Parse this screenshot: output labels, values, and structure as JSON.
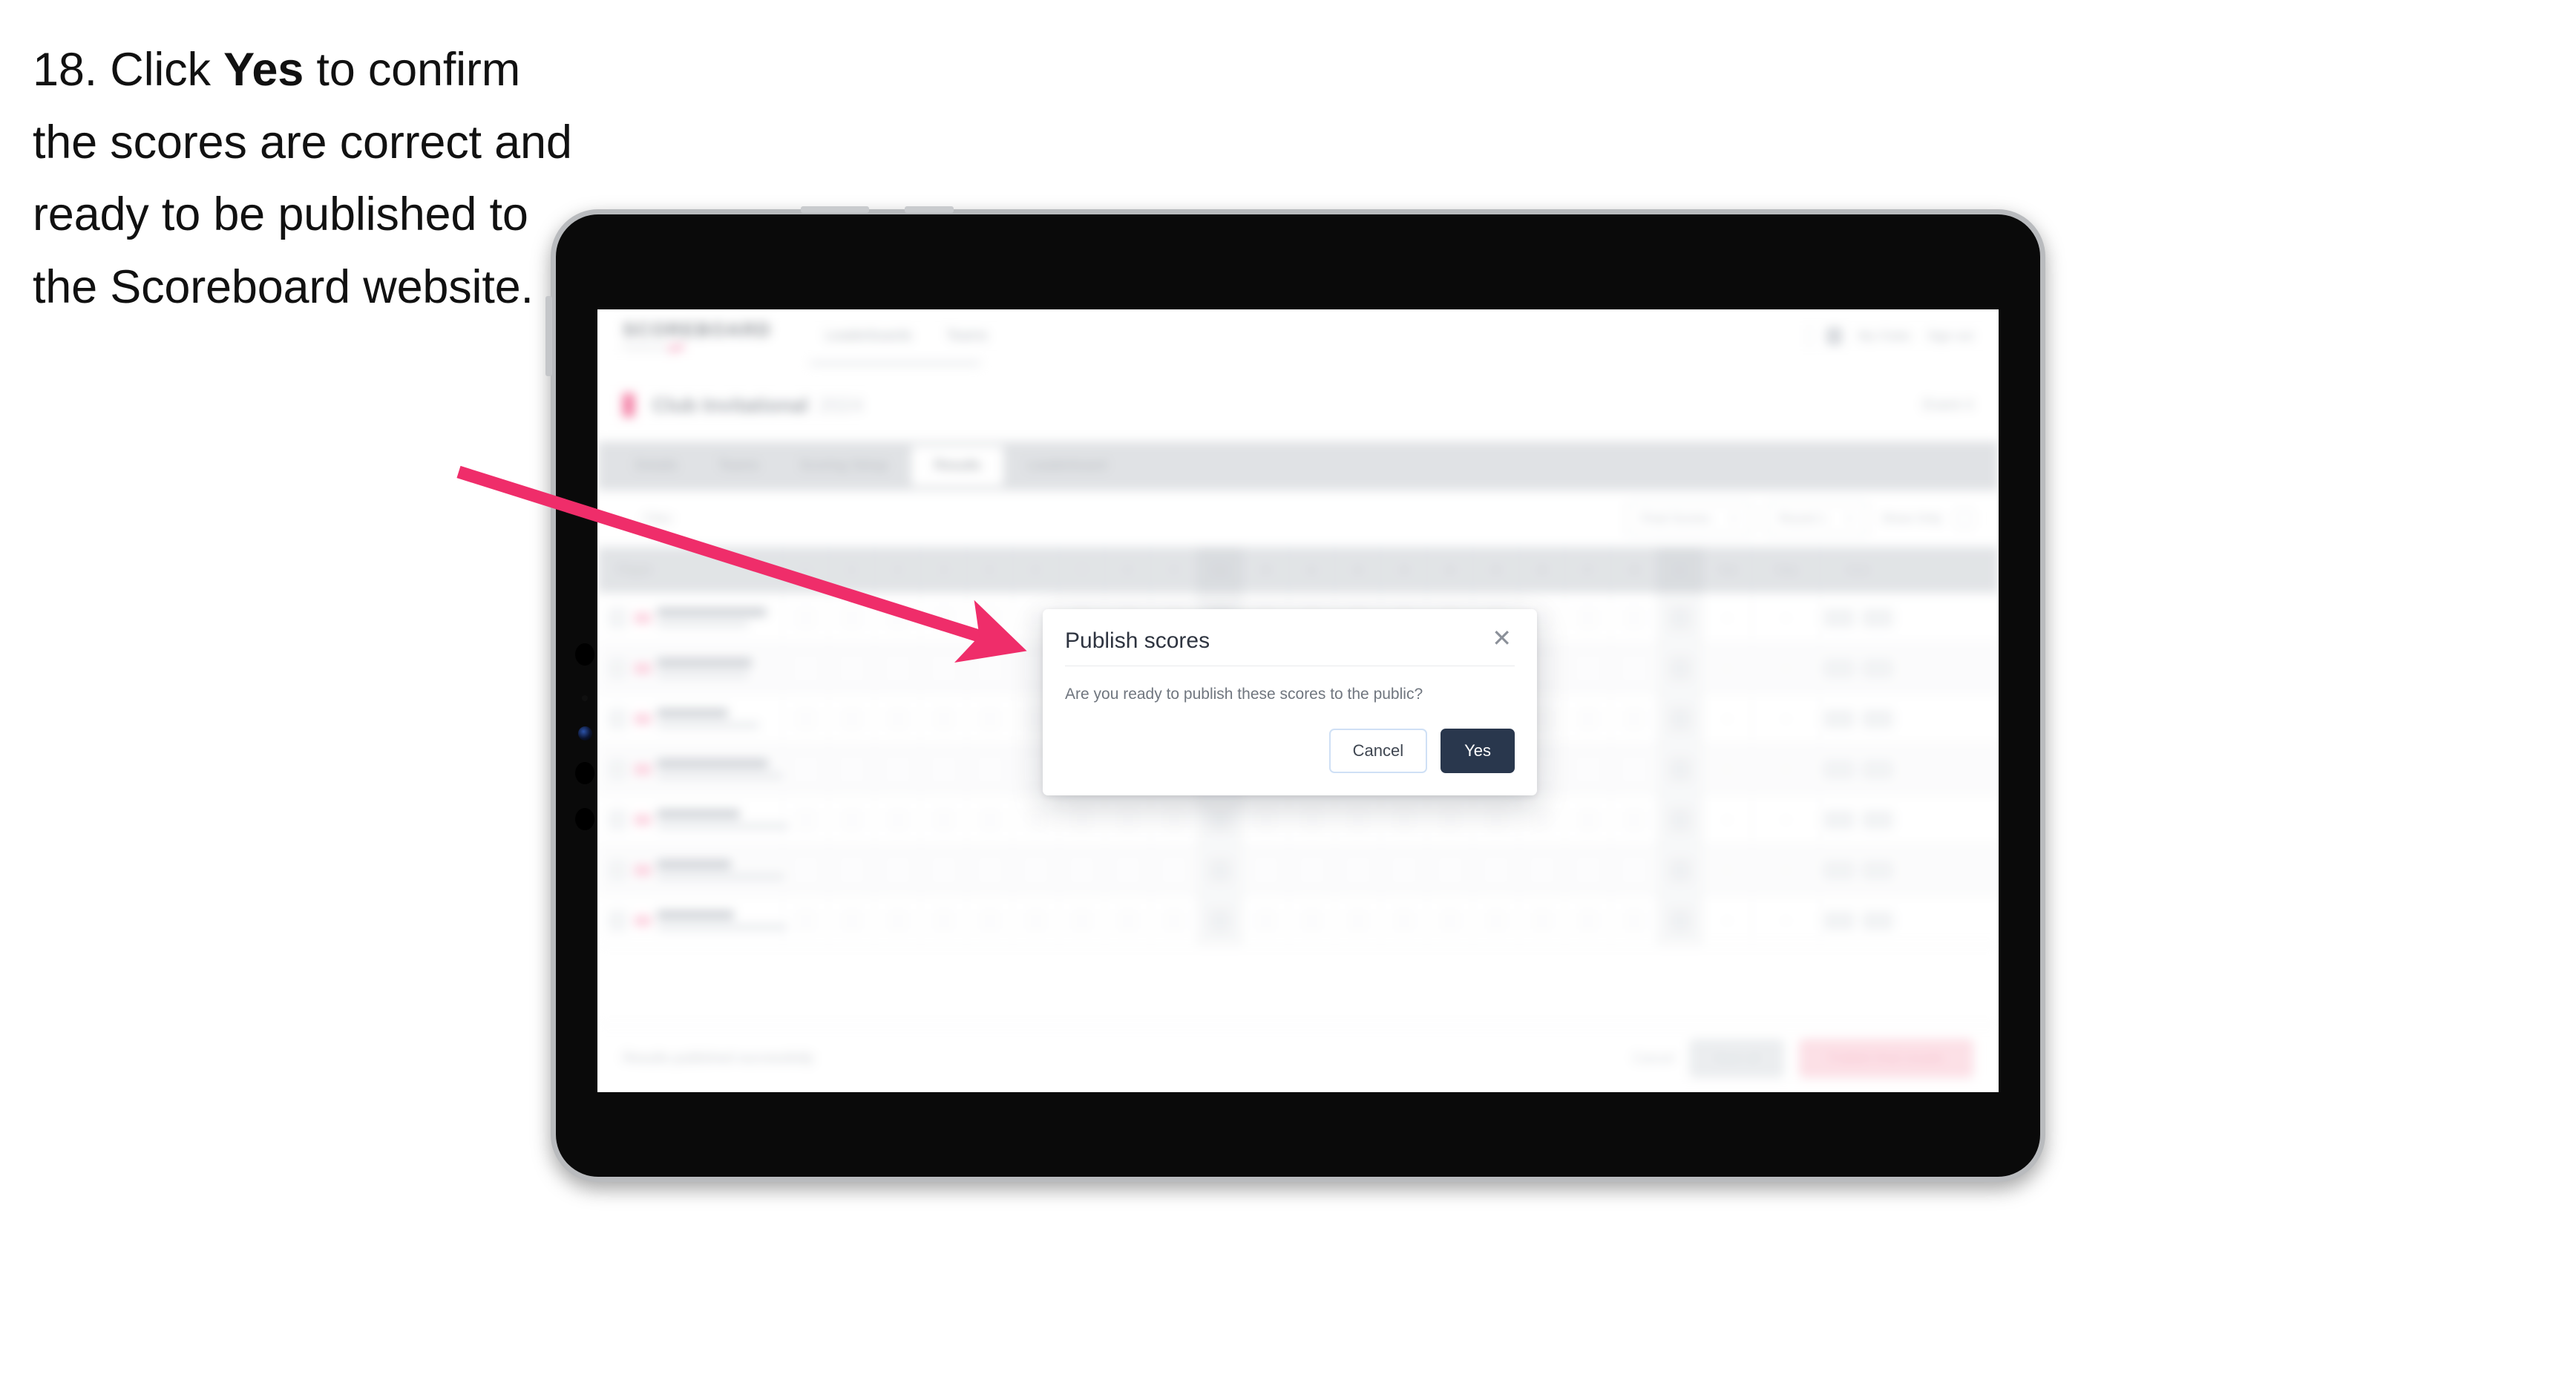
{
  "caption": {
    "step": "18. Click ",
    "bold": "Yes",
    "rest": " to confirm the scores are correct and ready to be published to the Scoreboard website."
  },
  "colors": {
    "accent_pink": "#ef2d6a",
    "brand_pink": "#e8296b",
    "modal_primary": "#29374d",
    "device_frame": "#b9bbbe"
  },
  "modal": {
    "title": "Publish scores",
    "close_icon": "close-icon",
    "body": "Are you ready to publish these scores to the public?",
    "cancel_label": "Cancel",
    "yes_label": "Yes"
  },
  "app": {
    "logo": {
      "main": "SCOREBOARD",
      "sub": "Powered by",
      "brand": "golf"
    },
    "header_nav": [
      "Leaderboards",
      "Teams"
    ],
    "header_right": [
      "My Clubs",
      "Sign out"
    ],
    "event": {
      "title": "Club Invitational",
      "sub": "2024",
      "right": "Event 4"
    },
    "tabs": [
      "Details",
      "Teams",
      "Scoring Setup",
      "Results",
      "Leaderboard"
    ],
    "active_tab": "Results",
    "filters": {
      "left": "Filter",
      "select_1": "Final Scores",
      "select_2": "Round 1",
      "plain": "Show Only",
      "toggle": "toggle-checkbox"
    },
    "table": {
      "columns": [
        "Player",
        "1",
        "2",
        "3",
        "4",
        "5",
        "6",
        "7",
        "8",
        "9",
        "Out",
        "10",
        "11",
        "12",
        "13",
        "14",
        "15",
        "16",
        "17",
        "18",
        "In",
        "Total",
        "Today",
        "Score"
      ],
      "rows": [
        {
          "pos": "1",
          "name": "Marcus Turner",
          "team": "Crest Valley Golf",
          "name_w": 148,
          "team_w": 124
        },
        {
          "pos": "2",
          "name": "Finn Parnell",
          "team": "Crest Valley Golf",
          "name_w": 128,
          "team_w": 124
        },
        {
          "pos": "3",
          "name": "Cameron Robertson",
          "team": "Lakeside Country Club",
          "name_w": 96,
          "team_w": 138
        },
        {
          "pos": "4",
          "name": "Chris Waterman",
          "team": "Northpark Golf Club",
          "name_w": 150,
          "team_w": 170
        },
        {
          "pos": "5",
          "name": "Oliver Ward",
          "team": "Northpark Golf Club",
          "name_w": 112,
          "team_w": 178
        },
        {
          "pos": "6",
          "name": "Ryan Britt",
          "team": "Northpark Golf Club",
          "name_w": 100,
          "team_w": 172
        },
        {
          "pos": "7",
          "name": "Nick Bailey",
          "team": "Southwind Golf Club",
          "name_w": 104,
          "team_w": 176
        }
      ]
    },
    "footer": {
      "note": "Results published successfully",
      "link": "Cancel",
      "grey_button": "Save all",
      "pink_button": "Publish final results"
    }
  },
  "device": {
    "type": "tablet",
    "camera_cluster": "camera-array-icon"
  }
}
